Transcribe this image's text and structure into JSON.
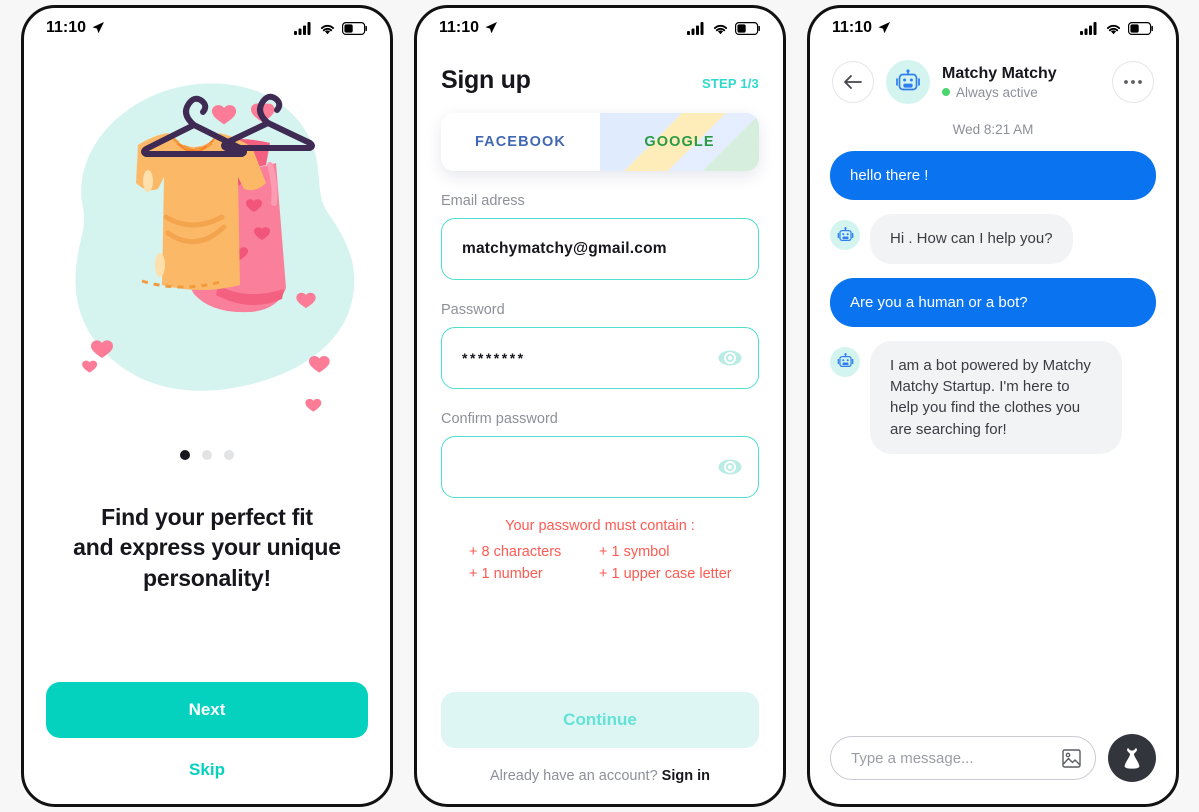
{
  "status_bar": {
    "time": "11:10",
    "battery_level": 40
  },
  "colors": {
    "teal": "#04d2bf",
    "teal_light": "#4fdfd0",
    "blue_bubble": "#0a74f0",
    "error_red": "#ff5a52",
    "facebook_blue": "#4268b3",
    "google_green": "#2a9a46",
    "mint_blob": "#d5f3ef"
  },
  "onboarding": {
    "illustration": "clothes-on-hangers-illustration",
    "dots": {
      "count": 3,
      "active_index": 0
    },
    "headline": "Find your perfect fit and express your unique personality!",
    "headline_lines": [
      "Find your perfect fit",
      "and express your unique",
      "personality!"
    ],
    "next_label": "Next",
    "skip_label": "Skip"
  },
  "signup": {
    "title": "Sign up",
    "step": "STEP 1/3",
    "tabs": [
      {
        "label": "FACEBOOK",
        "name": "facebook"
      },
      {
        "label": "GOOGLE",
        "name": "google"
      }
    ],
    "fields": {
      "email": {
        "label": "Email adress",
        "value": "matchymatchy@gmail.com",
        "placeholder": ""
      },
      "password": {
        "label": "Password",
        "value": "********",
        "placeholder": ""
      },
      "confirm_password": {
        "label": "Confirm password",
        "value": "",
        "placeholder": ""
      }
    },
    "password_rules": {
      "title": "Your password must contain :",
      "items": [
        "+ 8 characters",
        "+ 1 symbol",
        "+ 1 number",
        "+ 1 upper case letter"
      ]
    },
    "continue_label": "Continue",
    "footer_text": "Already have an account?",
    "footer_link": "Sign in"
  },
  "chat": {
    "peer_name": "Matchy Matchy",
    "peer_status": "Always active",
    "timestamp": "Wed 8:21 AM",
    "messages": [
      {
        "from": "me",
        "text": "hello there !"
      },
      {
        "from": "bot",
        "text": "Hi . How can I help you?"
      },
      {
        "from": "me",
        "text": "Are you a human or a bot?"
      },
      {
        "from": "bot",
        "text": "I am a bot powered by Matchy Matchy Startup. I'm here to help you find the clothes you are searching for!"
      }
    ],
    "input_placeholder": "Type a message...",
    "input_value": ""
  }
}
